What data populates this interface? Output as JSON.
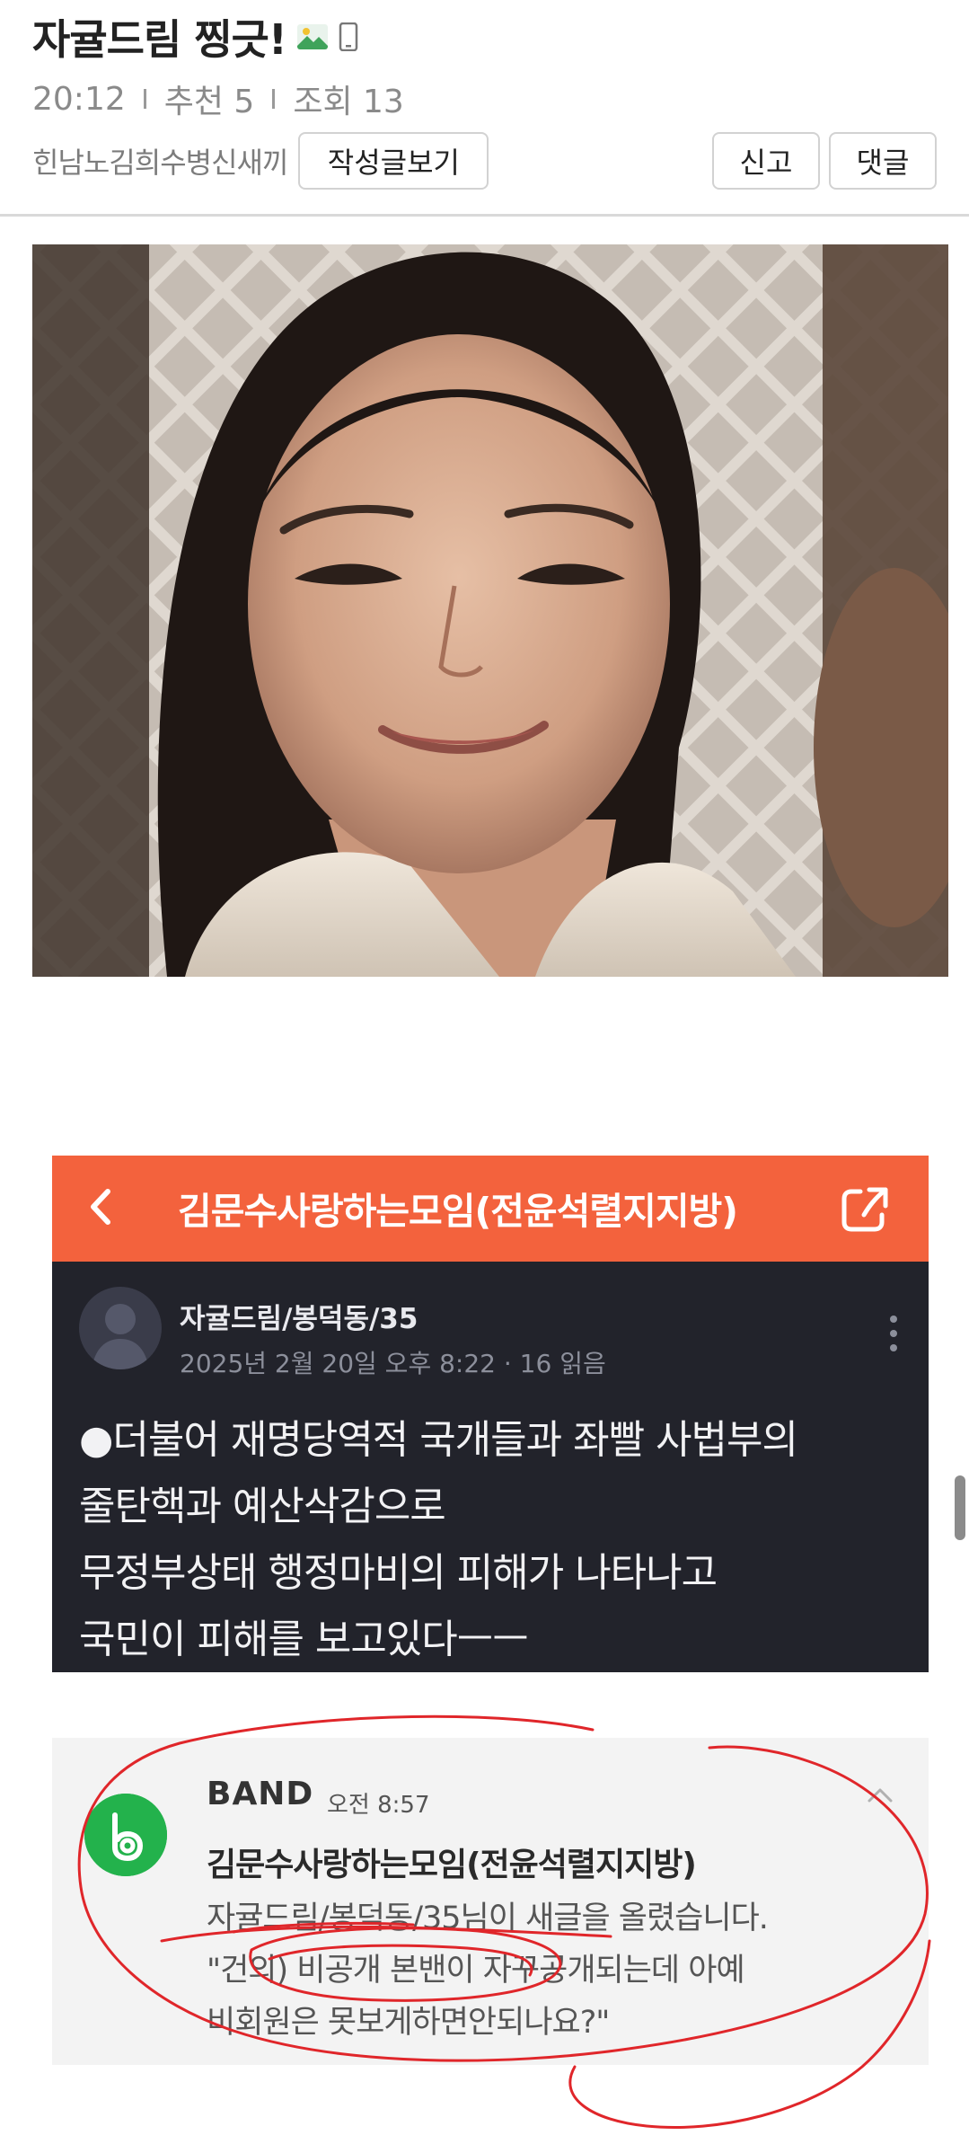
{
  "post": {
    "title": "자귤드림 찡긋!",
    "time": "20:12",
    "recommend": "추천 5",
    "views": "조회 13",
    "author": "힌남노김희수병신새끼",
    "buttons": {
      "my_posts": "작성글보기",
      "report": "신고",
      "comments": "댓글"
    },
    "icons": [
      "image-icon",
      "mobile-icon"
    ]
  },
  "band_screenshot": {
    "group_title": "김문수사랑하는모임(전윤석렬지지방)",
    "poster": "자귤드림/봉덕동/35",
    "post_meta": "2025년 2월 20일 오후 8:22 · 16 읽음",
    "body_lines": [
      "●더불어 재명당역적 국개들과 좌빨 사법부의",
      "줄탄핵과  예산삭감으로",
      "무정부상태  행정마비의 피해가 나타나고",
      "국민이  피해를 보고있다ㅡㅡ"
    ],
    "topbar_color": "#f3623d"
  },
  "notification_screenshot": {
    "app_name": "BAND",
    "time": "오전 8:57",
    "group_title": "김문수사랑하는모임(전윤석렬지지방)",
    "message_lines": [
      "자귤드림/봉덕동/35님이 새글을 올렸습니다.",
      "\"건의) 비공개 본밴이 자꾸공개되는데 아예",
      "비회원은 못보게하면안되나요?\""
    ],
    "logo_color": "#23b24c"
  },
  "annotation_color": "#e0262a"
}
